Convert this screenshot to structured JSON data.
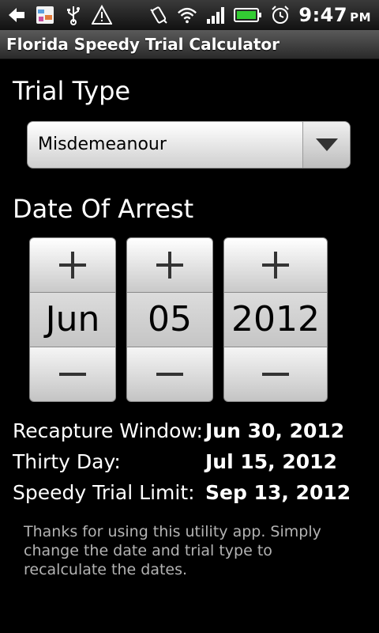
{
  "status_bar": {
    "time": "9:47",
    "ampm": "PM",
    "left_icons": [
      "back-arrow-icon",
      "app-notification-icon",
      "usb-icon",
      "warning-icon"
    ],
    "right_icons": [
      "vibrate-icon",
      "wifi-icon",
      "signal-icon",
      "battery-icon",
      "alarm-icon"
    ]
  },
  "app": {
    "title": "Florida Speedy Trial Calculator"
  },
  "trial_type": {
    "label": "Trial Type",
    "selected": "Misdemeanour"
  },
  "date_of_arrest": {
    "label": "Date Of Arrest",
    "month": "Jun",
    "day": "05",
    "year": "2012"
  },
  "results": {
    "recapture_label": "Recapture Window:",
    "recapture_value": "Jun 30, 2012",
    "thirty_label": "Thirty Day:",
    "thirty_value": "Jul 15, 2012",
    "limit_label": "Speedy Trial Limit:",
    "limit_value": "Sep 13, 2012"
  },
  "note": "Thanks for using this utility app. Simply change the date and trial type to recalculate the dates.",
  "colors": {
    "background": "#000000",
    "battery": "#33cc33",
    "note_text": "#b3b3b3"
  }
}
